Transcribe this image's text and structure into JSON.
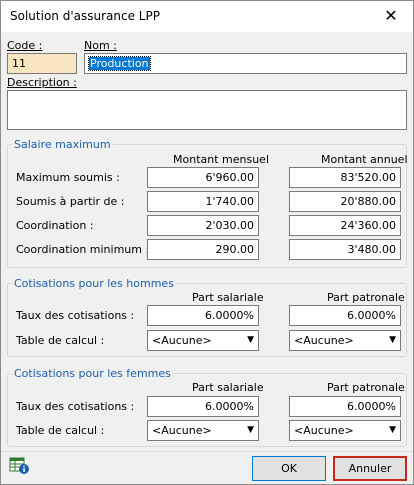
{
  "window": {
    "title": "Solution d'assurance LPP",
    "close_glyph": "✕"
  },
  "header": {
    "code_label": "Code :",
    "nom_label": "Nom :",
    "code_value": "11",
    "nom_value": "Production",
    "description_label": "Description :",
    "description_value": ""
  },
  "salaire": {
    "title": "Salaire maximum",
    "col_mensuel": "Montant mensuel",
    "col_annuel": "Montant annuel",
    "rows": [
      {
        "label": "Maximum soumis :",
        "mensuel": "6'960.00",
        "annuel": "83'520.00"
      },
      {
        "label": "Soumis à partir de :",
        "mensuel": "1'740.00",
        "annuel": "20'880.00"
      },
      {
        "label": "Coordination :",
        "mensuel": "2'030.00",
        "annuel": "24'360.00"
      },
      {
        "label": "Coordination minimum :",
        "mensuel": "290.00",
        "annuel": "3'480.00"
      }
    ]
  },
  "hommes": {
    "title": "Cotisations pour les hommes",
    "col_salariale": "Part salariale",
    "col_patronale": "Part patronale",
    "taux_label": "Taux des cotisations :",
    "taux_salariale": "6.0000%",
    "taux_patronale": "6.0000%",
    "table_label": "Table de calcul :",
    "table_salariale": "<Aucune>",
    "table_patronale": "<Aucune>"
  },
  "femmes": {
    "title": "Cotisations pour les femmes",
    "col_salariale": "Part salariale",
    "col_patronale": "Part patronale",
    "taux_label": "Taux des cotisations :",
    "taux_salariale": "6.0000%",
    "taux_patronale": "6.0000%",
    "table_label": "Table de calcul :",
    "table_salariale": "<Aucune>",
    "table_patronale": "<Aucune>"
  },
  "footer": {
    "ok_label": "OK",
    "cancel_label": "Annuler",
    "help_icon": "info-table-icon"
  },
  "colors": {
    "accent": "#0078d7",
    "group_title": "#1a5fb4",
    "code_bg": "#f7e6c0",
    "cancel_border": "#c42b1c"
  }
}
